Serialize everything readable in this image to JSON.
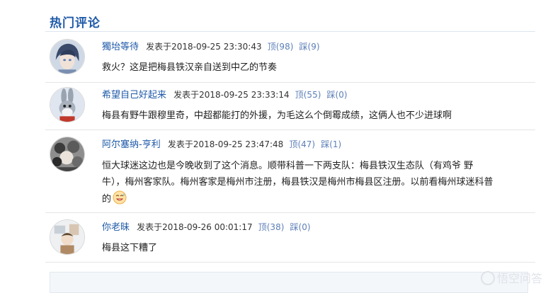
{
  "section": {
    "title": "热门评论"
  },
  "comments": [
    {
      "user": "獨坮等待",
      "posted": "发表于2018-09-25 23:30:43",
      "up": "顶(98)",
      "down": "踩(9)",
      "text": "救火？这是把梅县铁汉亲自送到中乙的节奏"
    },
    {
      "user": "希望自己好起来",
      "posted": "发表于2018-09-25 23:33:14",
      "up": "顶(55)",
      "down": "踩(0)",
      "text": "梅县有野牛跟穆里奇，中超都能打的外援，为毛这么个倒霉成绩，这俩人也不少进球啊"
    },
    {
      "user": "阿尔塞纳-亨利",
      "posted": "发表于2018-09-25 23:47:48",
      "up": "顶(47)",
      "down": "踩(1)",
      "text_lines": [
        "恒大球迷这边也是今晚收到了这个消息。顺带科普一下两支队：梅县铁汉生态队（有鸡爷 野",
        "牛），梅州客家队。梅州客家是梅州市注册，梅县铁汉是梅州市梅县区注册。以前看梅州球迷科普",
        "的"
      ],
      "emoji": "sweat-smile-emoji"
    },
    {
      "user": "你老昧",
      "posted": "发表于2018-09-26 00:01:17",
      "up": "顶(38)",
      "down": "踩(0)",
      "text": "梅县这下糟了"
    }
  ],
  "watermark": "悟空问答",
  "colors": {
    "link": "#1f5aa8",
    "vote": "#5d7fb8",
    "divider": "#e5e5e5"
  }
}
